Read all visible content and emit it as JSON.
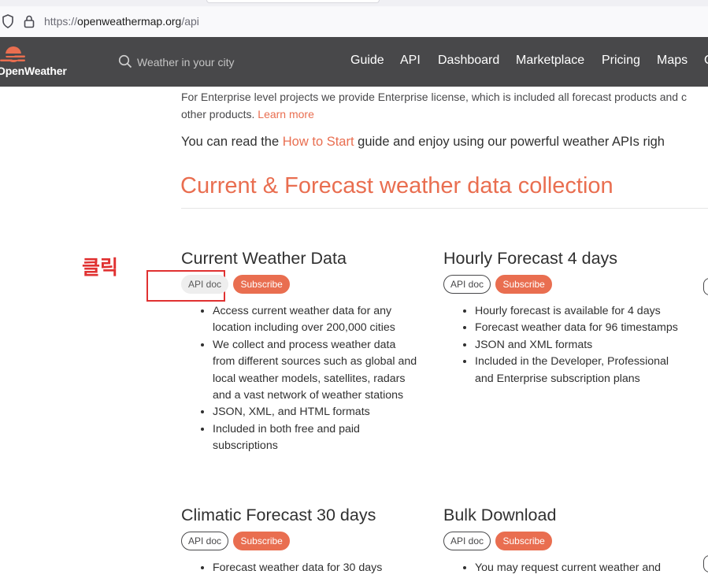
{
  "browser": {
    "url_prefix": "https://",
    "url_host": "openweathermap.org",
    "url_path": "/api"
  },
  "nav": {
    "logo_text": "OpenWeather",
    "search_placeholder": "Weather in your city",
    "links": [
      "Guide",
      "API",
      "Dashboard",
      "Marketplace",
      "Pricing",
      "Maps",
      "C"
    ]
  },
  "intro": {
    "enterprise_line1": "For Enterprise level projects we provide Enterprise license, which is included all forecast products and c",
    "enterprise_line2": "other products.",
    "learn_more": "Learn more",
    "read_prefix": "You can read the",
    "how_to_start": "How to Start",
    "read_suffix": "guide and enjoy using our powerful weather APIs righ"
  },
  "section_title": "Current & Forecast weather data collection",
  "annotation": "클릭",
  "cards": [
    {
      "title": "Current Weather Data",
      "api_doc": "API doc",
      "subscribe": "Subscribe",
      "bullets": [
        "Access current weather data for any location including over 200,000 cities",
        "We collect and process weather data from different sources such as global and local weather models, satellites, radars and a vast network of weather stations",
        "JSON, XML, and HTML formats",
        "Included in both free and paid subscriptions"
      ]
    },
    {
      "title": "Hourly Forecast 4 days",
      "api_doc": "API doc",
      "subscribe": "Subscribe",
      "bullets": [
        "Hourly forecast is available for 4 days",
        "Forecast weather data for 96 timestamps",
        "JSON and XML formats",
        "Included in the Developer, Professional and Enterprise subscription plans"
      ]
    },
    {
      "title": "Climatic Forecast 30 days",
      "api_doc": "API doc",
      "subscribe": "Subscribe",
      "bullets": [
        "Forecast weather data for 30 days"
      ]
    },
    {
      "title": "Bulk Download",
      "api_doc": "API doc",
      "subscribe": "Subscribe",
      "bullets": [
        "You may request current weather and"
      ]
    }
  ],
  "colors": {
    "accent": "#e96e50",
    "nav_bg": "#48484a",
    "annotation": "#e03131"
  }
}
